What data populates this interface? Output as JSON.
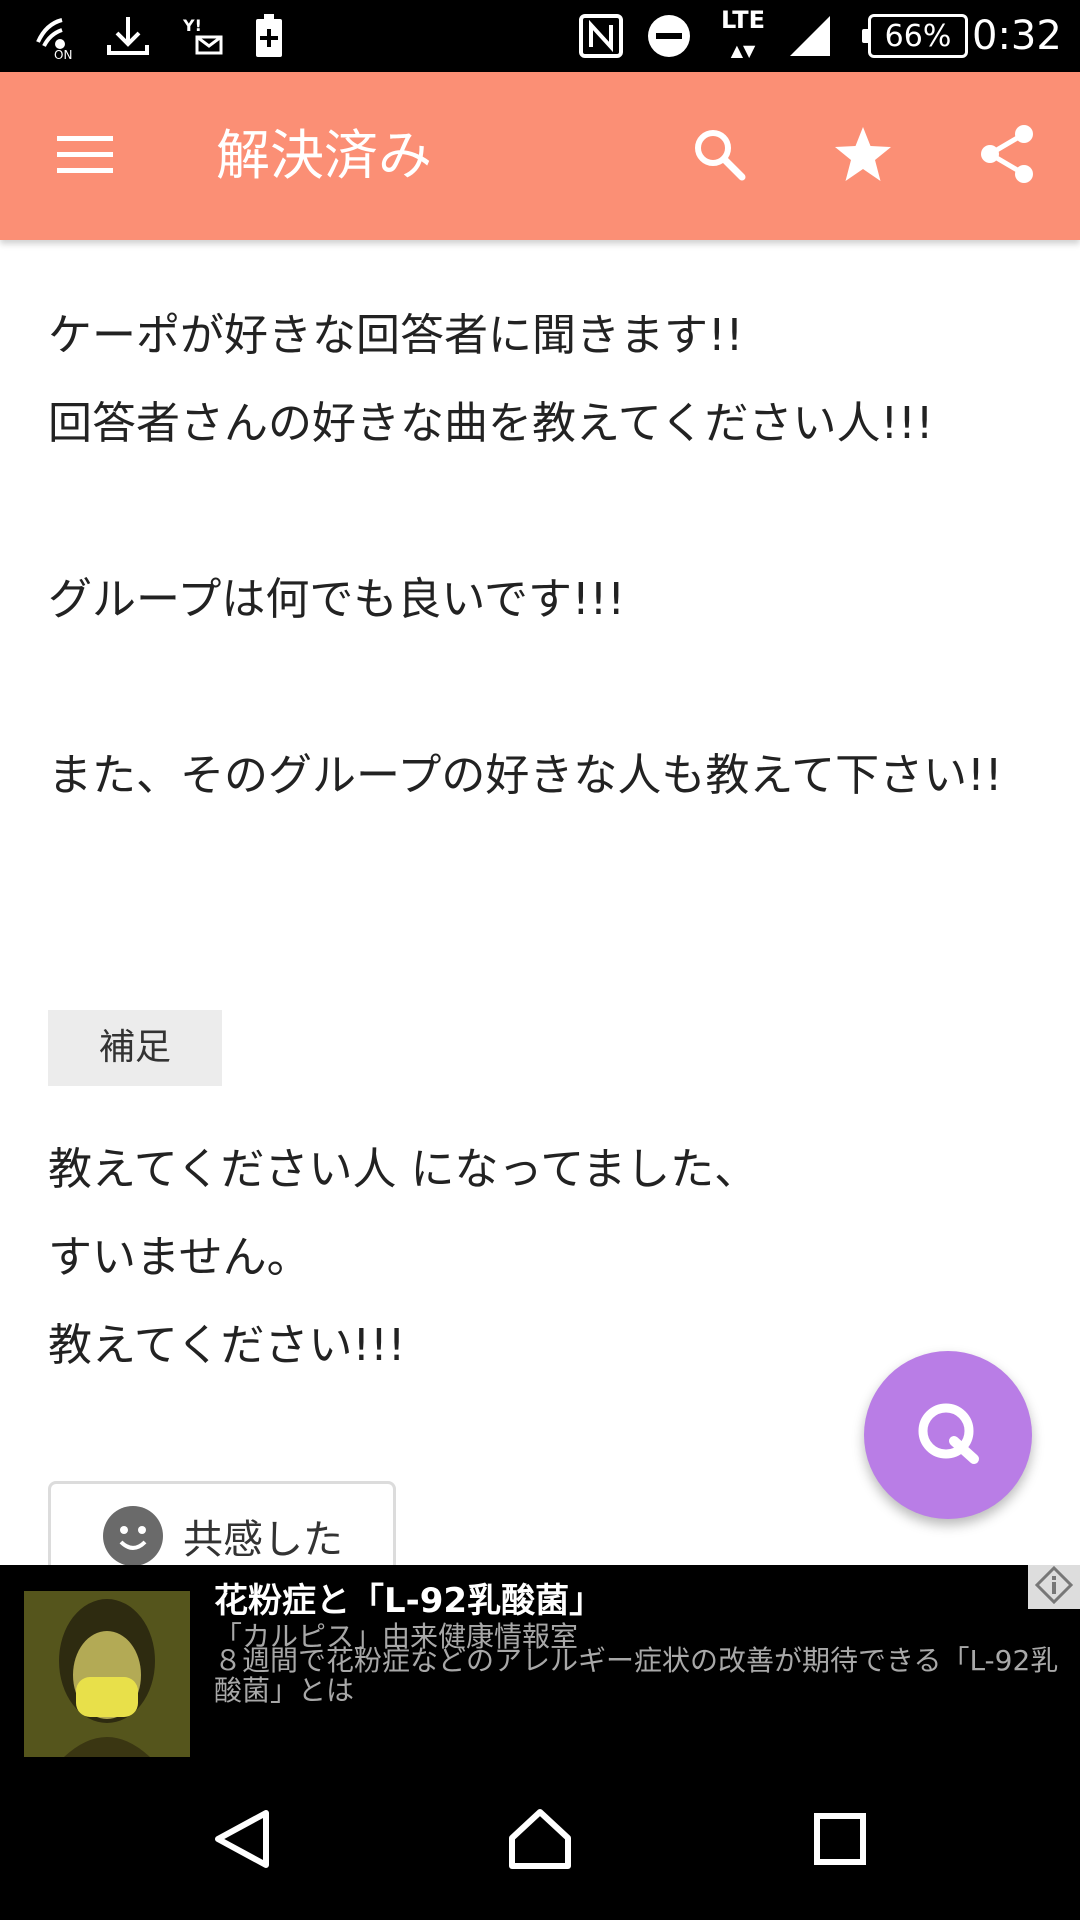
{
  "status_bar": {
    "lte_label": "LTE",
    "battery_text": "66%",
    "time": "0:32",
    "icons": [
      "wifi-calling-icon",
      "download-icon",
      "yahoo-mail-icon",
      "battery-saver-icon",
      "nfc-icon",
      "do-not-disturb-icon",
      "lte-icon",
      "signal-icon",
      "battery-icon"
    ]
  },
  "app_bar": {
    "title": "解決済み",
    "color": "#fb8f75",
    "icons": [
      "menu-icon",
      "search-icon",
      "star-icon",
      "share-icon"
    ]
  },
  "question": {
    "body": "ケーポが好きな回答者に聞きます!!\n回答者さんの好きな曲を教えてください人!!!\n\nグループは何でも良いです!!!\n\nまた、そのグループの好きな人も教えて下さい!!"
  },
  "supplement": {
    "badge": "補足",
    "body": "教えてください人 になってました、\nすいません。\n教えてください!!!"
  },
  "empathy_button": {
    "label": "共感した",
    "icon": "smiley-icon"
  },
  "fab": {
    "icon": "q-search-icon",
    "color": "#b97de6"
  },
  "ad": {
    "title": "花粉症と「L-92乳酸菌」",
    "source": "「カルピス」由来健康情報室",
    "description": "８週間で花粉症などのアレルギー症状の改善が期待できる「L-92乳酸菌」とは",
    "icon": "ad-info-icon"
  },
  "nav_bar": {
    "icons": [
      "back-icon",
      "home-icon",
      "recents-icon"
    ]
  }
}
